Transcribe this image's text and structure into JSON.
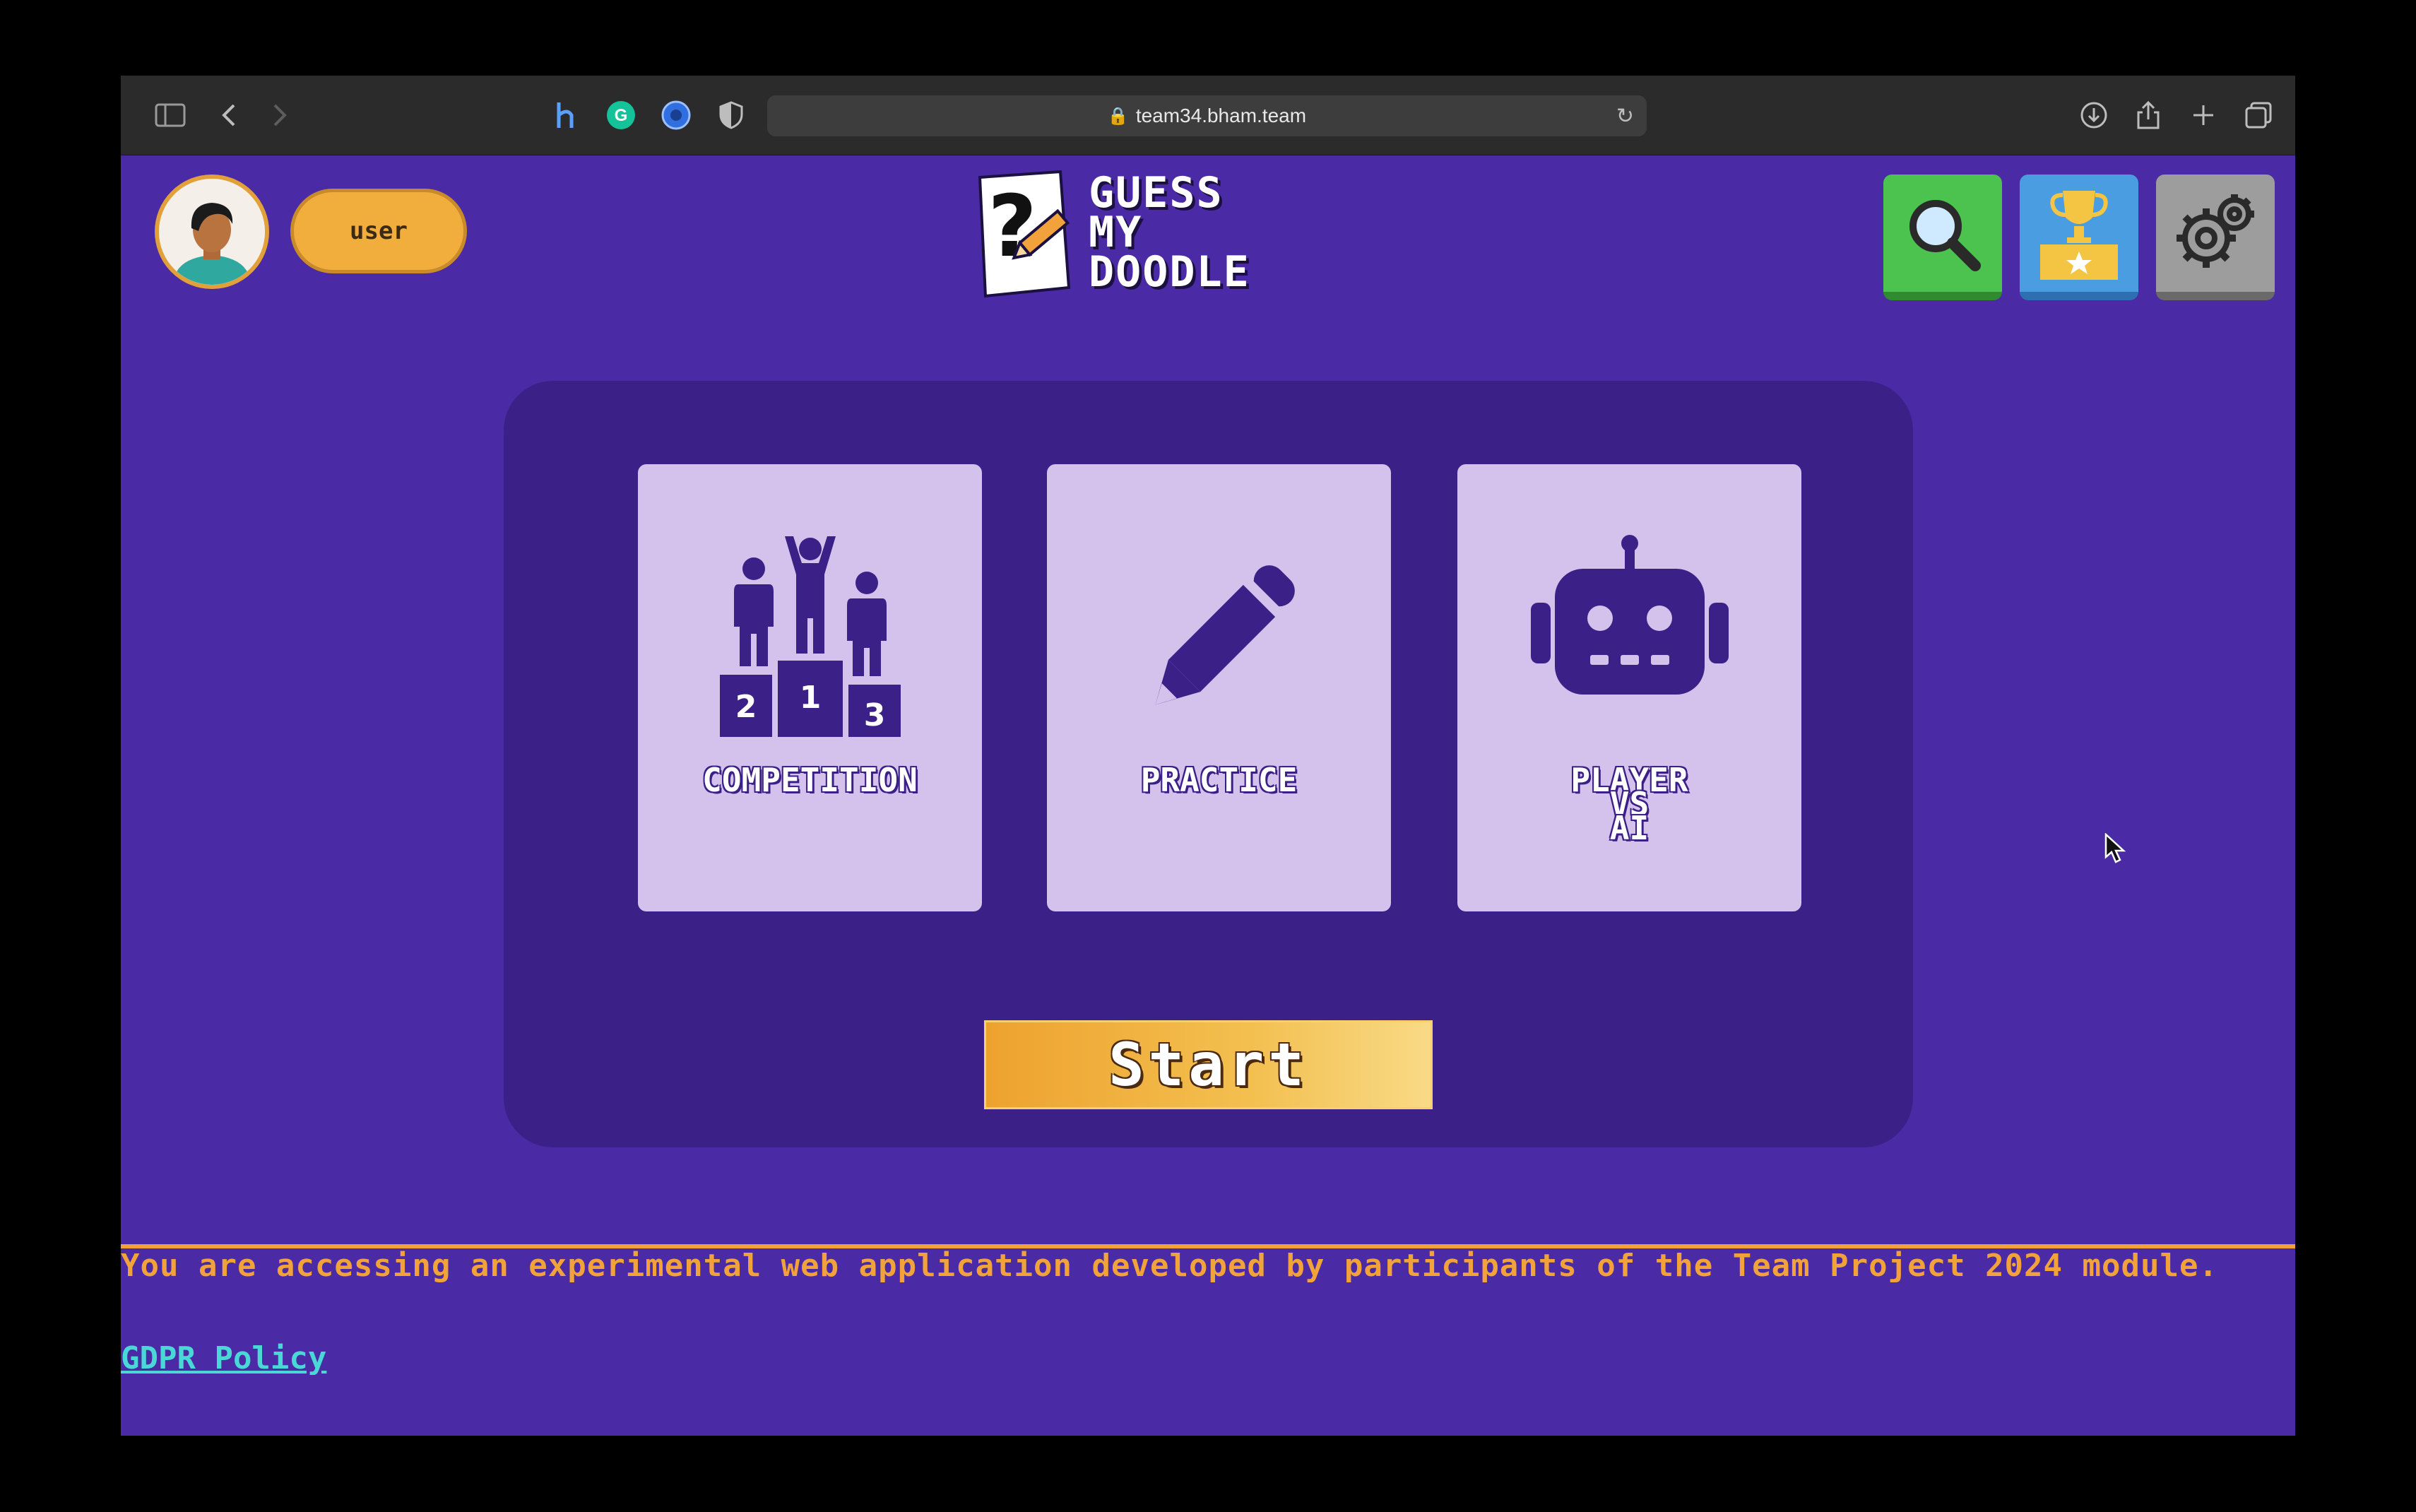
{
  "browser": {
    "url": "team34.bham.team",
    "icons": [
      "sidebar-icon",
      "back-icon",
      "forward-icon",
      "extension-h-icon",
      "grammarly-icon",
      "extension-blue-icon",
      "shield-icon",
      "download-icon",
      "share-icon",
      "new-tab-icon",
      "tabs-overview-icon"
    ]
  },
  "header": {
    "username": "user",
    "logo_lines": [
      "GUESS",
      "MY",
      "DOODLE"
    ]
  },
  "modes": [
    {
      "label": "COMPETITION",
      "icon": "podium-icon"
    },
    {
      "label": "PRACTICE",
      "icon": "pencil-icon"
    },
    {
      "label": "PLAYER\nVS\nAI",
      "icon": "robot-icon"
    }
  ],
  "start_label": "Start",
  "footer": {
    "notice": "You are accessing an experimental web application developed by participants of the Team Project 2024 module.",
    "gdpr_link": "GDPR Policy"
  },
  "colors": {
    "background": "#4a2aa5",
    "panel": "#3b2187",
    "card": "#d4c2ec",
    "accent": "#f2a23a",
    "link": "#49d8d6"
  }
}
